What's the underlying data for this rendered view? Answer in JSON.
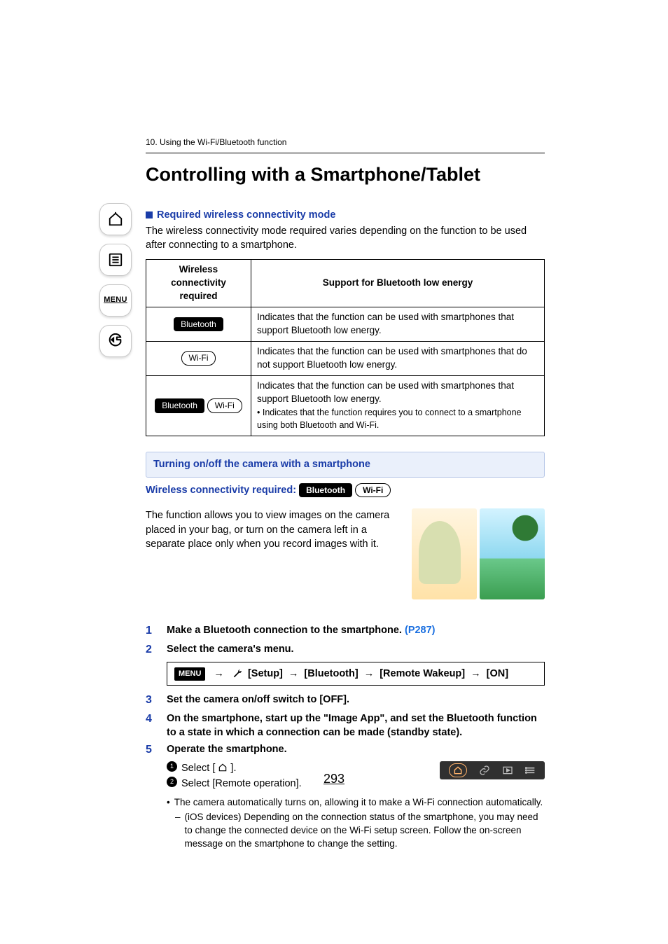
{
  "sidebar": {
    "menu_label": "MENU"
  },
  "breadcrumb": "10. Using the Wi-Fi/Bluetooth function",
  "title": "Controlling with a Smartphone/Tablet",
  "req_mode": {
    "heading": "Required wireless connectivity mode",
    "text": "The wireless connectivity mode required varies depending on the function to be used after connecting to a smartphone."
  },
  "table": {
    "col_required": "Wireless connectivity required",
    "col_support": "Support for Bluetooth low energy",
    "rows": [
      {
        "badge_dark": "Bluetooth",
        "badge_light": "",
        "desc": "Indicates that the function can be used with smartphones that support Bluetooth low energy."
      },
      {
        "badge_dark": "",
        "badge_light": "Wi-Fi",
        "desc": "Indicates that the function can be used with smartphones that do not support Bluetooth low energy."
      },
      {
        "badge_dark": "Bluetooth",
        "badge_light": "Wi-Fi",
        "desc_main": "Indicates that the function can be used with smartphones that support Bluetooth low energy.",
        "desc_sub": "Indicates that the function requires you to connect to a smartphone using both Bluetooth and Wi-Fi."
      }
    ]
  },
  "section": {
    "header": "Turning on/off the camera with a smartphone",
    "wireless_label": "Wireless connectivity required:",
    "badge_dark": "Bluetooth",
    "badge_light": "Wi-Fi",
    "description": "The function allows you to view images on the camera placed in your bag, or turn on the camera left in a separate place only when you record images with it."
  },
  "steps": {
    "s1_a": "Make a Bluetooth connection to the smartphone. ",
    "s1_link": "(P287)",
    "s2": "Select the camera's menu.",
    "menu_path": {
      "menu_chip": "MENU",
      "setup": "[Setup]",
      "bluetooth": "[Bluetooth]",
      "remote": "[Remote Wakeup]",
      "on": "[ON]"
    },
    "s3": "Set the camera on/off switch to [OFF].",
    "s4": "On the smartphone, start up the \"Image App\", and set the Bluetooth function to a state in which a connection can be made (standby state).",
    "s5": "Operate the smartphone.",
    "sub1a": "Select [",
    "sub1b": "].",
    "sub2": "Select [Remote operation].",
    "note1": "The camera automatically turns on, allowing it to make a Wi-Fi connection automatically.",
    "note2": "(iOS devices) Depending on the connection status of the smartphone, you may need to change the connected device on the Wi-Fi setup screen. Follow the on-screen message on the smartphone to change the setting."
  },
  "page_number": "293"
}
